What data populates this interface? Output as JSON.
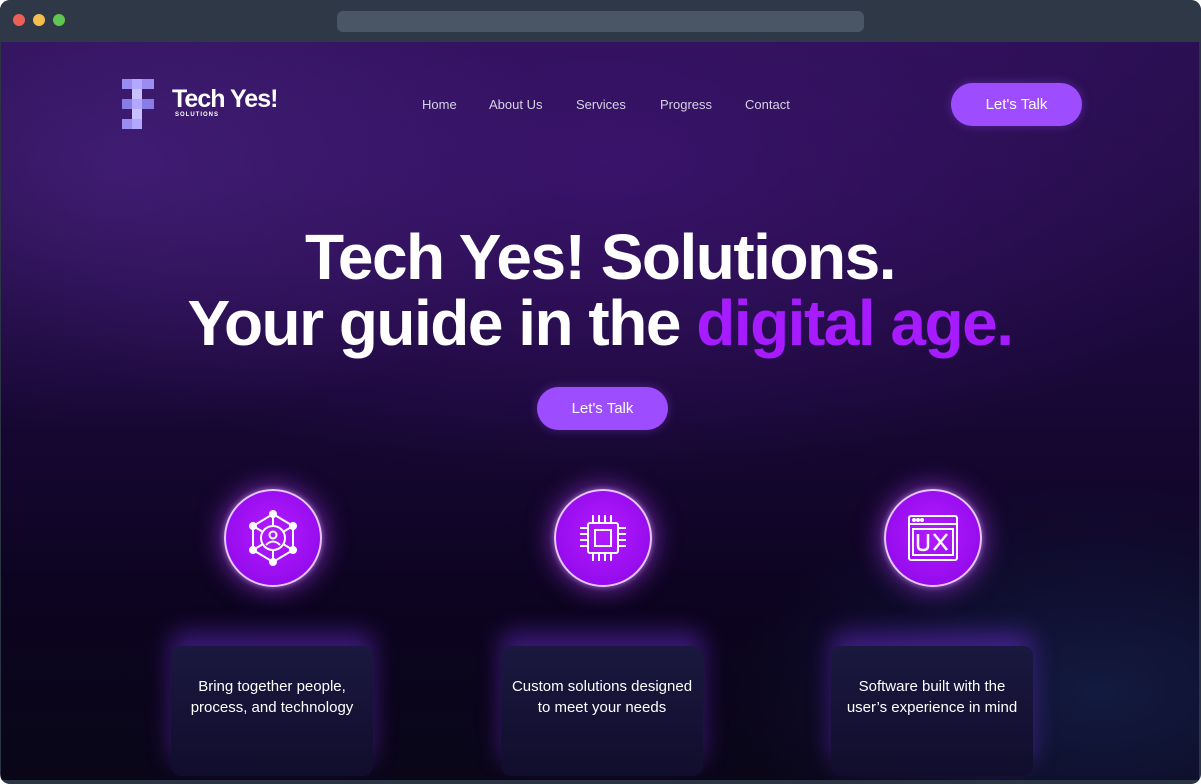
{
  "brand": {
    "name": "Tech Yes!",
    "tagline": "SOLUTIONS",
    "accent_color": "#9d4dff",
    "highlight_color": "#a61bff"
  },
  "nav": {
    "items": [
      "Home",
      "About Us",
      "Services",
      "Progress",
      "Contact"
    ],
    "cta_label": "Let's Talk"
  },
  "hero": {
    "line1": "Tech Yes! Solutions.",
    "line2_plain": "Your guide in the ",
    "line2_accent": "digital age.",
    "cta_label": "Let's Talk"
  },
  "features": [
    {
      "icon": "network-people-icon",
      "text": "Bring together people, process, and technology"
    },
    {
      "icon": "cpu-chip-icon",
      "text": "Custom solutions designed to meet your needs"
    },
    {
      "icon": "ux-window-icon",
      "text": "Software built with the user’s experience in mind"
    }
  ]
}
